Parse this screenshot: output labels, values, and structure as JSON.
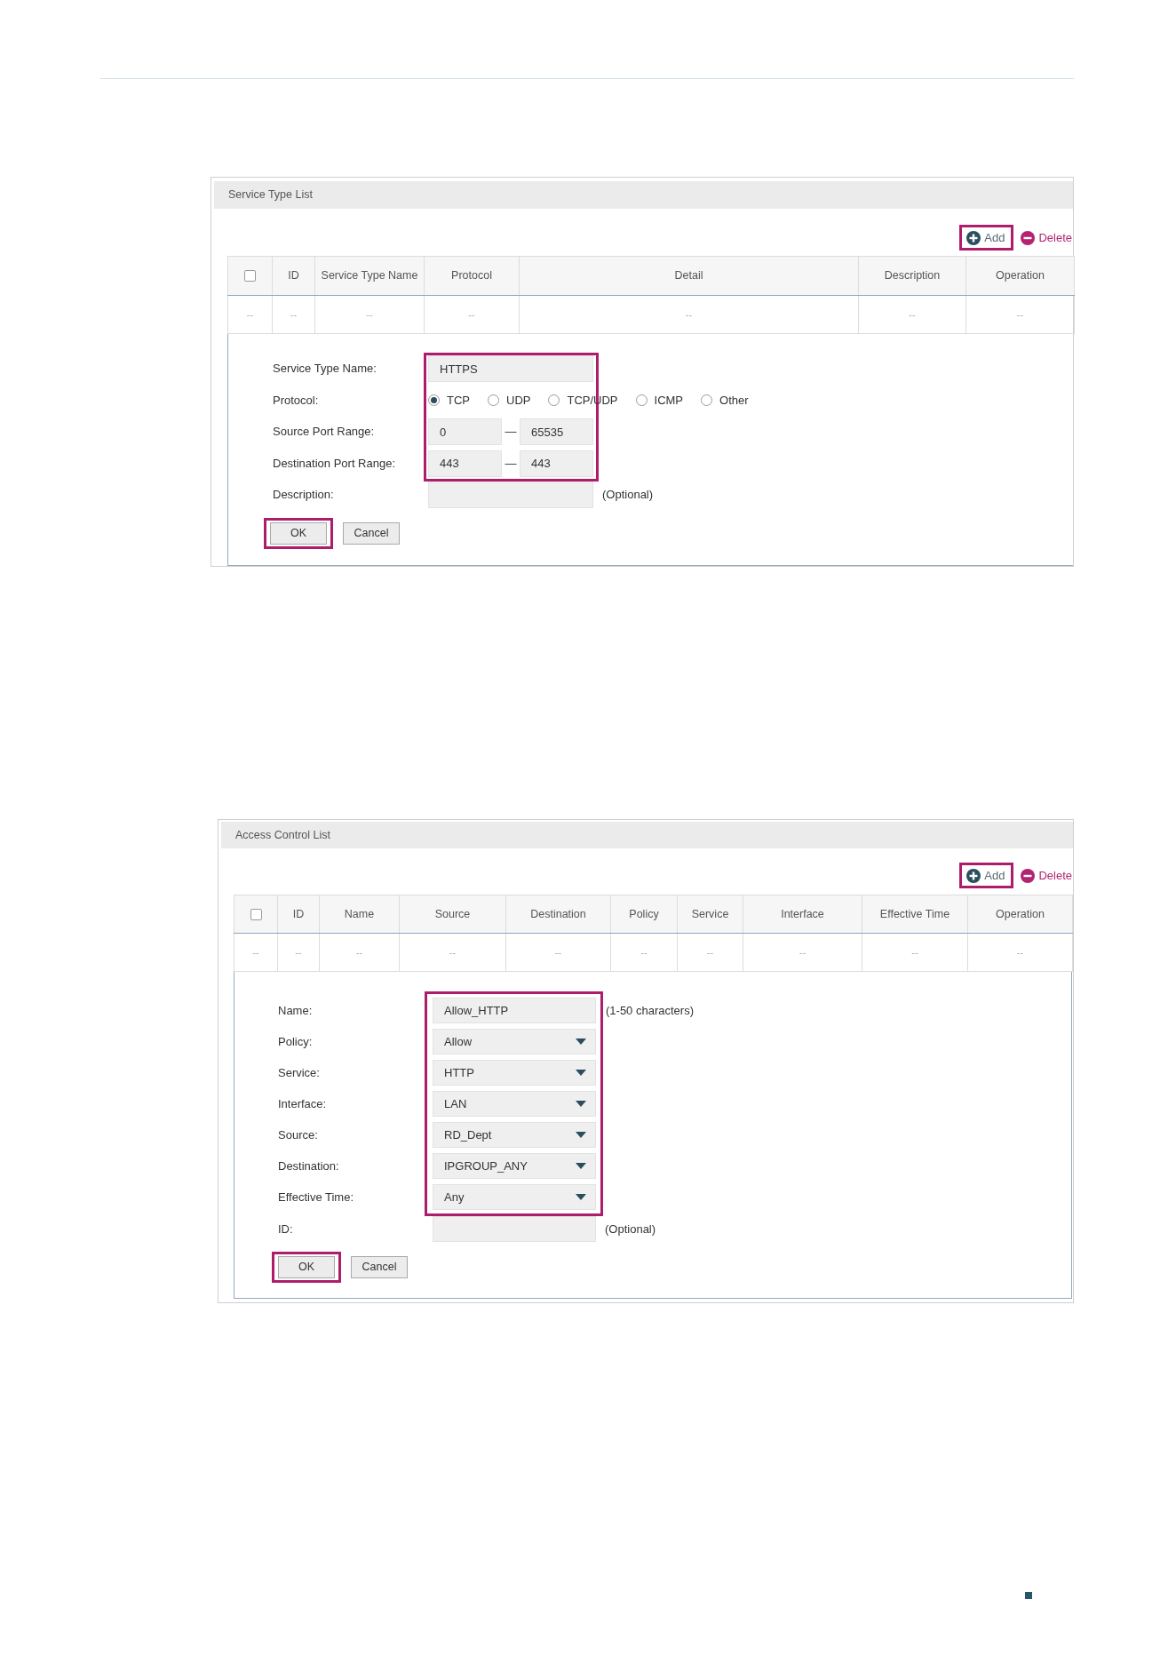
{
  "panels": [
    {
      "title": "Service Type List",
      "toolbar": [
        {
          "kind": "add",
          "label": "Add",
          "highlighted": true
        },
        {
          "kind": "delete",
          "label": "Delete",
          "highlighted": false
        }
      ],
      "table": {
        "columns": [
          {
            "kind": "checkbox",
            "checked": false
          },
          {
            "kind": "text",
            "label": "ID"
          },
          {
            "kind": "text",
            "label": "Service Type Name"
          },
          {
            "kind": "text",
            "label": "Protocol"
          },
          {
            "kind": "text",
            "label": "Detail"
          },
          {
            "kind": "text",
            "label": "Description"
          },
          {
            "kind": "text",
            "label": "Operation"
          }
        ],
        "rows": [
          [
            "--",
            "--",
            "--",
            "--",
            "--",
            "--",
            "--"
          ]
        ]
      },
      "form": {
        "groups": [
          {
            "highlighted": true,
            "fields": [
              {
                "kind": "text",
                "label": "Service Type Name:",
                "value": "HTTPS"
              },
              {
                "kind": "radio",
                "label": "Protocol:",
                "options": [
                  {
                    "label": "TCP",
                    "selected": true
                  },
                  {
                    "label": "UDP",
                    "selected": false
                  },
                  {
                    "label": "TCP/UDP",
                    "selected": false
                  },
                  {
                    "label": "ICMP",
                    "selected": false
                  },
                  {
                    "label": "Other",
                    "selected": false
                  }
                ]
              },
              {
                "kind": "range",
                "label": "Source Port Range:",
                "from": "0",
                "separator": "—",
                "to": "65535"
              },
              {
                "kind": "range",
                "label": "Destination Port Range:",
                "from": "443",
                "separator": "—",
                "to": "443"
              }
            ]
          },
          {
            "highlighted": false,
            "fields": [
              {
                "kind": "text",
                "label": "Description:",
                "note": "(Optional)"
              }
            ]
          }
        ],
        "buttons": [
          {
            "label": "OK",
            "highlighted": true
          },
          {
            "label": "Cancel",
            "highlighted": false
          }
        ]
      }
    },
    {
      "title": "Access Control List",
      "toolbar": [
        {
          "kind": "add",
          "label": "Add",
          "highlighted": true
        },
        {
          "kind": "delete",
          "label": "Delete",
          "highlighted": false
        }
      ],
      "table": {
        "columns": [
          {
            "kind": "checkbox",
            "checked": false
          },
          {
            "kind": "text",
            "label": "ID"
          },
          {
            "kind": "text",
            "label": "Name"
          },
          {
            "kind": "text",
            "label": "Source"
          },
          {
            "kind": "text",
            "label": "Destination"
          },
          {
            "kind": "text",
            "label": "Policy"
          },
          {
            "kind": "text",
            "label": "Service"
          },
          {
            "kind": "text",
            "label": "Interface"
          },
          {
            "kind": "text",
            "label": "Effective Time"
          },
          {
            "kind": "text",
            "label": "Operation"
          }
        ],
        "rows": [
          [
            "--",
            "--",
            "--",
            "--",
            "--",
            "--",
            "--",
            "--",
            "--",
            "--"
          ]
        ]
      },
      "form": {
        "groups": [
          {
            "highlighted": true,
            "fields": [
              {
                "kind": "text",
                "label": "Name:",
                "value": "Allow_HTTP",
                "note": "(1-50 characters)"
              },
              {
                "kind": "select",
                "label": "Policy:",
                "value": "Allow"
              },
              {
                "kind": "select",
                "label": "Service:",
                "value": "HTTP"
              },
              {
                "kind": "select",
                "label": "Interface:",
                "value": "LAN"
              },
              {
                "kind": "select",
                "label": "Source:",
                "value": "RD_Dept"
              },
              {
                "kind": "select",
                "label": "Destination:",
                "value": "IPGROUP_ANY"
              },
              {
                "kind": "select",
                "label": "Effective Time:",
                "value": "Any"
              }
            ]
          },
          {
            "highlighted": false,
            "fields": [
              {
                "kind": "text",
                "label": "ID:",
                "note": "(Optional)"
              }
            ]
          }
        ],
        "buttons": [
          {
            "label": "OK",
            "highlighted": true
          },
          {
            "label": "Cancel",
            "highlighted": false
          }
        ]
      }
    }
  ]
}
